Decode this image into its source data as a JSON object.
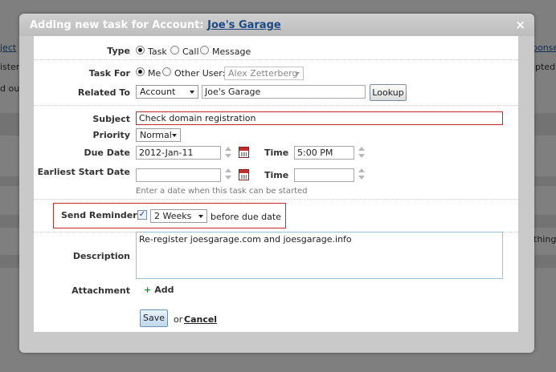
{
  "background": {
    "top_left": "ject",
    "row1_left": "ister",
    "row2_left": "d out",
    "top_right": "ponse",
    "row1_right": "pted",
    "row2_right": "thing"
  },
  "dialog": {
    "title_prefix": "Adding new task for Account:",
    "title_account": "Joe's Garage",
    "close_glyph": "×"
  },
  "form": {
    "type": {
      "label": "Type",
      "options": [
        "Task",
        "Call",
        "Message"
      ],
      "selected": "Task"
    },
    "task_for": {
      "label": "Task For",
      "me": "Me",
      "other": "Other User:",
      "selected": "Me",
      "other_user_value": "Alex Zetterberg"
    },
    "related_to": {
      "label": "Related To",
      "type_value": "Account",
      "name_value": "Joe's Garage",
      "lookup_label": "Lookup"
    },
    "subject": {
      "label": "Subject",
      "value": "Check domain registration"
    },
    "priority": {
      "label": "Priority",
      "value": "Normal"
    },
    "due_date": {
      "label": "Due Date",
      "value": "2012-Jan-11",
      "time_label": "Time",
      "time_value": "5:00 PM"
    },
    "earliest_start": {
      "label": "Earliest Start Date",
      "value": "",
      "time_label": "Time",
      "time_value": "",
      "hint": "Enter a date when this task can be started"
    },
    "reminder": {
      "label": "Send Reminder",
      "checked": true,
      "period": "2 Weeks",
      "suffix": "before due date"
    },
    "description": {
      "label": "Description",
      "value": "Re-register joesgarage.com and joesgarage.info"
    },
    "attachment": {
      "label": "Attachment",
      "add_label": "Add"
    },
    "actions": {
      "save_label": "Save",
      "or_text": "or",
      "cancel_label": "Cancel"
    }
  },
  "colors": {
    "error_border": "#c0282d",
    "title_link": "#1c4a86",
    "add_plus": "#2e8b2e"
  },
  "icons": [
    "close-icon",
    "calendar-icon",
    "spinner-icon",
    "plus-icon",
    "check-icon"
  ]
}
